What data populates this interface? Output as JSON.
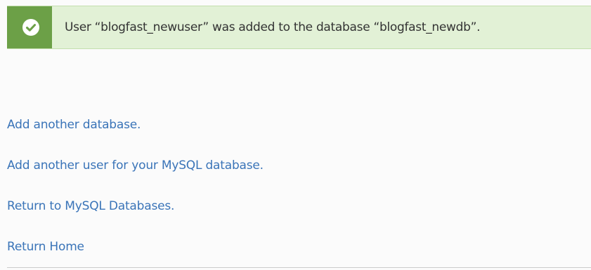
{
  "alert": {
    "icon": "check-circle-icon",
    "message": "User “blogfast_newuser” was added to the database “blogfast_newdb”.",
    "bar_color": "#6ca047",
    "background_color": "#e2f1d6"
  },
  "links": {
    "add_database": "Add another database.",
    "add_user": "Add another user for your MySQL database.",
    "return_mysql": "Return to MySQL Databases.",
    "return_home": "Return Home",
    "color": "#3a74b8"
  }
}
